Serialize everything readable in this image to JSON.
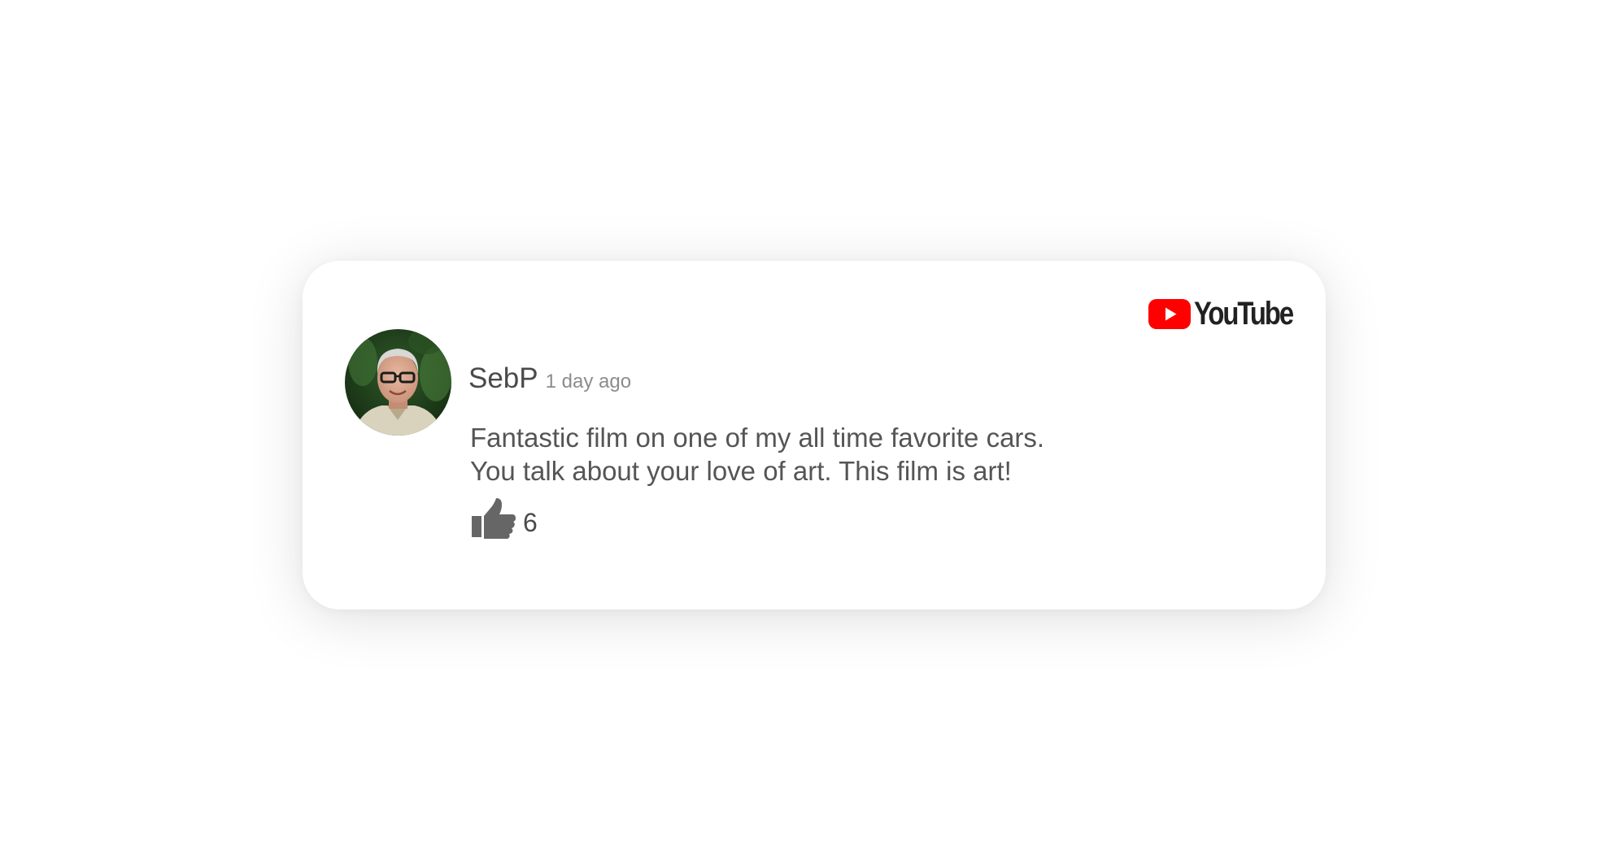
{
  "brand": {
    "wordmark": "YouTube",
    "icon": "youtube-play-icon",
    "color": "#ff0000"
  },
  "comment": {
    "author": "SebP",
    "timestamp": "1 day ago",
    "avatar_icon": "user-avatar-photo",
    "text_lines": [
      "Fantastic film on one of my all time favorite cars.",
      "You talk about your love of art. This film is art!"
    ],
    "likes": {
      "icon": "thumbs-up-icon",
      "count": "6"
    }
  }
}
